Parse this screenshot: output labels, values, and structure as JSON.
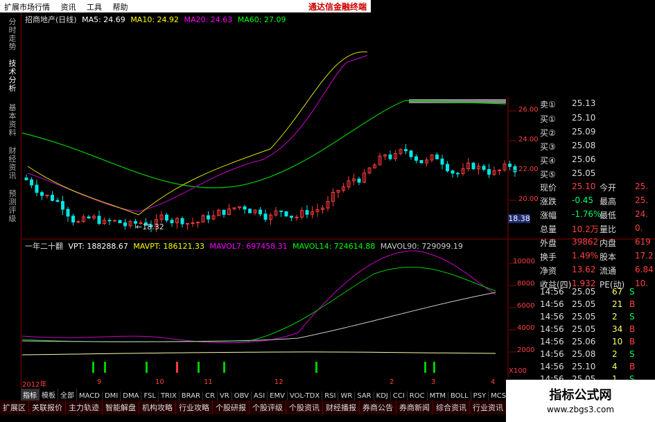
{
  "menubar": {
    "items": [
      "扩展市场行情",
      "资讯",
      "工具",
      "帮助"
    ],
    "brand": "通达信金融终端"
  },
  "side_tabs": [
    "分时走势",
    "技术分析",
    "基本资料",
    "财经资讯",
    "预测评级"
  ],
  "kline": {
    "title": "招商地产(日线)",
    "ma": [
      {
        "label": "MA5: 24.69",
        "color": "#ffffff"
      },
      {
        "label": "MA10: 24.92",
        "color": "#ffff00"
      },
      {
        "label": "MA20: 24.63",
        "color": "#ff00ff"
      },
      {
        "label": "MA60: 27.09",
        "color": "#00ff00"
      }
    ],
    "axis_labels": [
      "26.00",
      "24.00",
      "22.00",
      "20.00"
    ],
    "low_marker": "←18.32",
    "cursor_price": "18.38"
  },
  "indicator": {
    "name": "一年二十翻",
    "labels": [
      {
        "label": "VPT: 188288.67",
        "color": "#ffffff"
      },
      {
        "label": "MAVPT: 186121.33",
        "color": "#ffff00"
      },
      {
        "label": "MAVOL7: 697458.31",
        "color": "#ff00ff"
      },
      {
        "label": "MAVOL14: 724614.88",
        "color": "#00ff00"
      },
      {
        "label": "MAVOL90: 729099.19",
        "color": "#cccccc"
      }
    ],
    "axis_labels": [
      "10000",
      "8000",
      "6000",
      "4000",
      "2000"
    ],
    "axis_unit": "X100"
  },
  "date_axis": [
    "2012年",
    "9",
    "10",
    "11",
    "12",
    "2",
    "3",
    "4"
  ],
  "quote": {
    "orderbook": [
      {
        "label": "卖①",
        "price": "25.13"
      },
      {
        "label": "买①",
        "price": "25.10"
      },
      {
        "label": "买②",
        "price": "25.09"
      },
      {
        "label": "买③",
        "price": "25.08"
      },
      {
        "label": "买④",
        "price": "25.06"
      },
      {
        "label": "买⑤",
        "price": "25.05"
      }
    ],
    "stats": [
      {
        "l1": "现价",
        "v1": "25.10",
        "l2": "今开",
        "v2": "25."
      },
      {
        "l1": "涨跌",
        "v1": "-0.45",
        "l2": "最高",
        "v2": "25."
      },
      {
        "l1": "涨幅",
        "v1": "-1.76%",
        "l2": "最低",
        "v2": "24."
      },
      {
        "l1": "总量",
        "v1": "10.2万",
        "l2": "量比",
        "v2": "0."
      },
      {
        "l1": "外盘",
        "v1": "39862",
        "l2": "内盘",
        "v2": "619"
      },
      {
        "l1": "换手",
        "v1": "1.49%",
        "l2": "股本",
        "v2": "17.2"
      },
      {
        "l1": "净资",
        "v1": "13.62",
        "l2": "流通",
        "v2": "6.84"
      },
      {
        "l1": "收益(四)",
        "v1": "1.932",
        "l2": "PE(动)",
        "v2": "10."
      }
    ],
    "ticks": [
      {
        "time": "14:56",
        "price": "25.05",
        "vol": "67",
        "side": "S"
      },
      {
        "time": "14:56",
        "price": "25.05",
        "vol": "21",
        "side": "B"
      },
      {
        "time": "14:56",
        "price": "25.05",
        "vol": "2",
        "side": "S"
      },
      {
        "time": "14:56",
        "price": "25.05",
        "vol": "34",
        "side": "B"
      },
      {
        "time": "14:56",
        "price": "25.06",
        "vol": "10",
        "side": "B"
      },
      {
        "time": "14:56",
        "price": "25.08",
        "vol": "2",
        "side": "S"
      },
      {
        "time": "14:56",
        "price": "25.10",
        "vol": "4",
        "side": "B"
      },
      {
        "time": "14:56",
        "price": "25.05",
        "vol": "1",
        "side": "S"
      }
    ]
  },
  "tabs_indicators": [
    "指标",
    "模板",
    "全部",
    "MACD",
    "DMI",
    "DMA",
    "FSL",
    "TRIX",
    "BRAR",
    "CR",
    "VR",
    "OBV",
    "ASI",
    "EMV",
    "VOL-TDX",
    "RSI",
    "WR",
    "SAR",
    "KDJ",
    "CCI",
    "ROC",
    "MTM",
    "BOLL",
    "PSY",
    "MCST"
  ],
  "tabs_bottom": [
    "扩展区",
    "关联报价",
    "主力轨迹",
    "智能解盘",
    "机构攻略",
    "行业攻略",
    "个股研报",
    "个股评级",
    "个股资讯",
    "财经播报",
    "券商公告",
    "券商新闻",
    "综合资讯",
    "行业资讯",
    "资讯"
  ],
  "watermark": {
    "title": "指标公式网",
    "url": "www.zbgs3.com"
  },
  "colors": {
    "up": "#ff3b3b",
    "down": "#00e5e5",
    "grid": "#8b0000"
  }
}
